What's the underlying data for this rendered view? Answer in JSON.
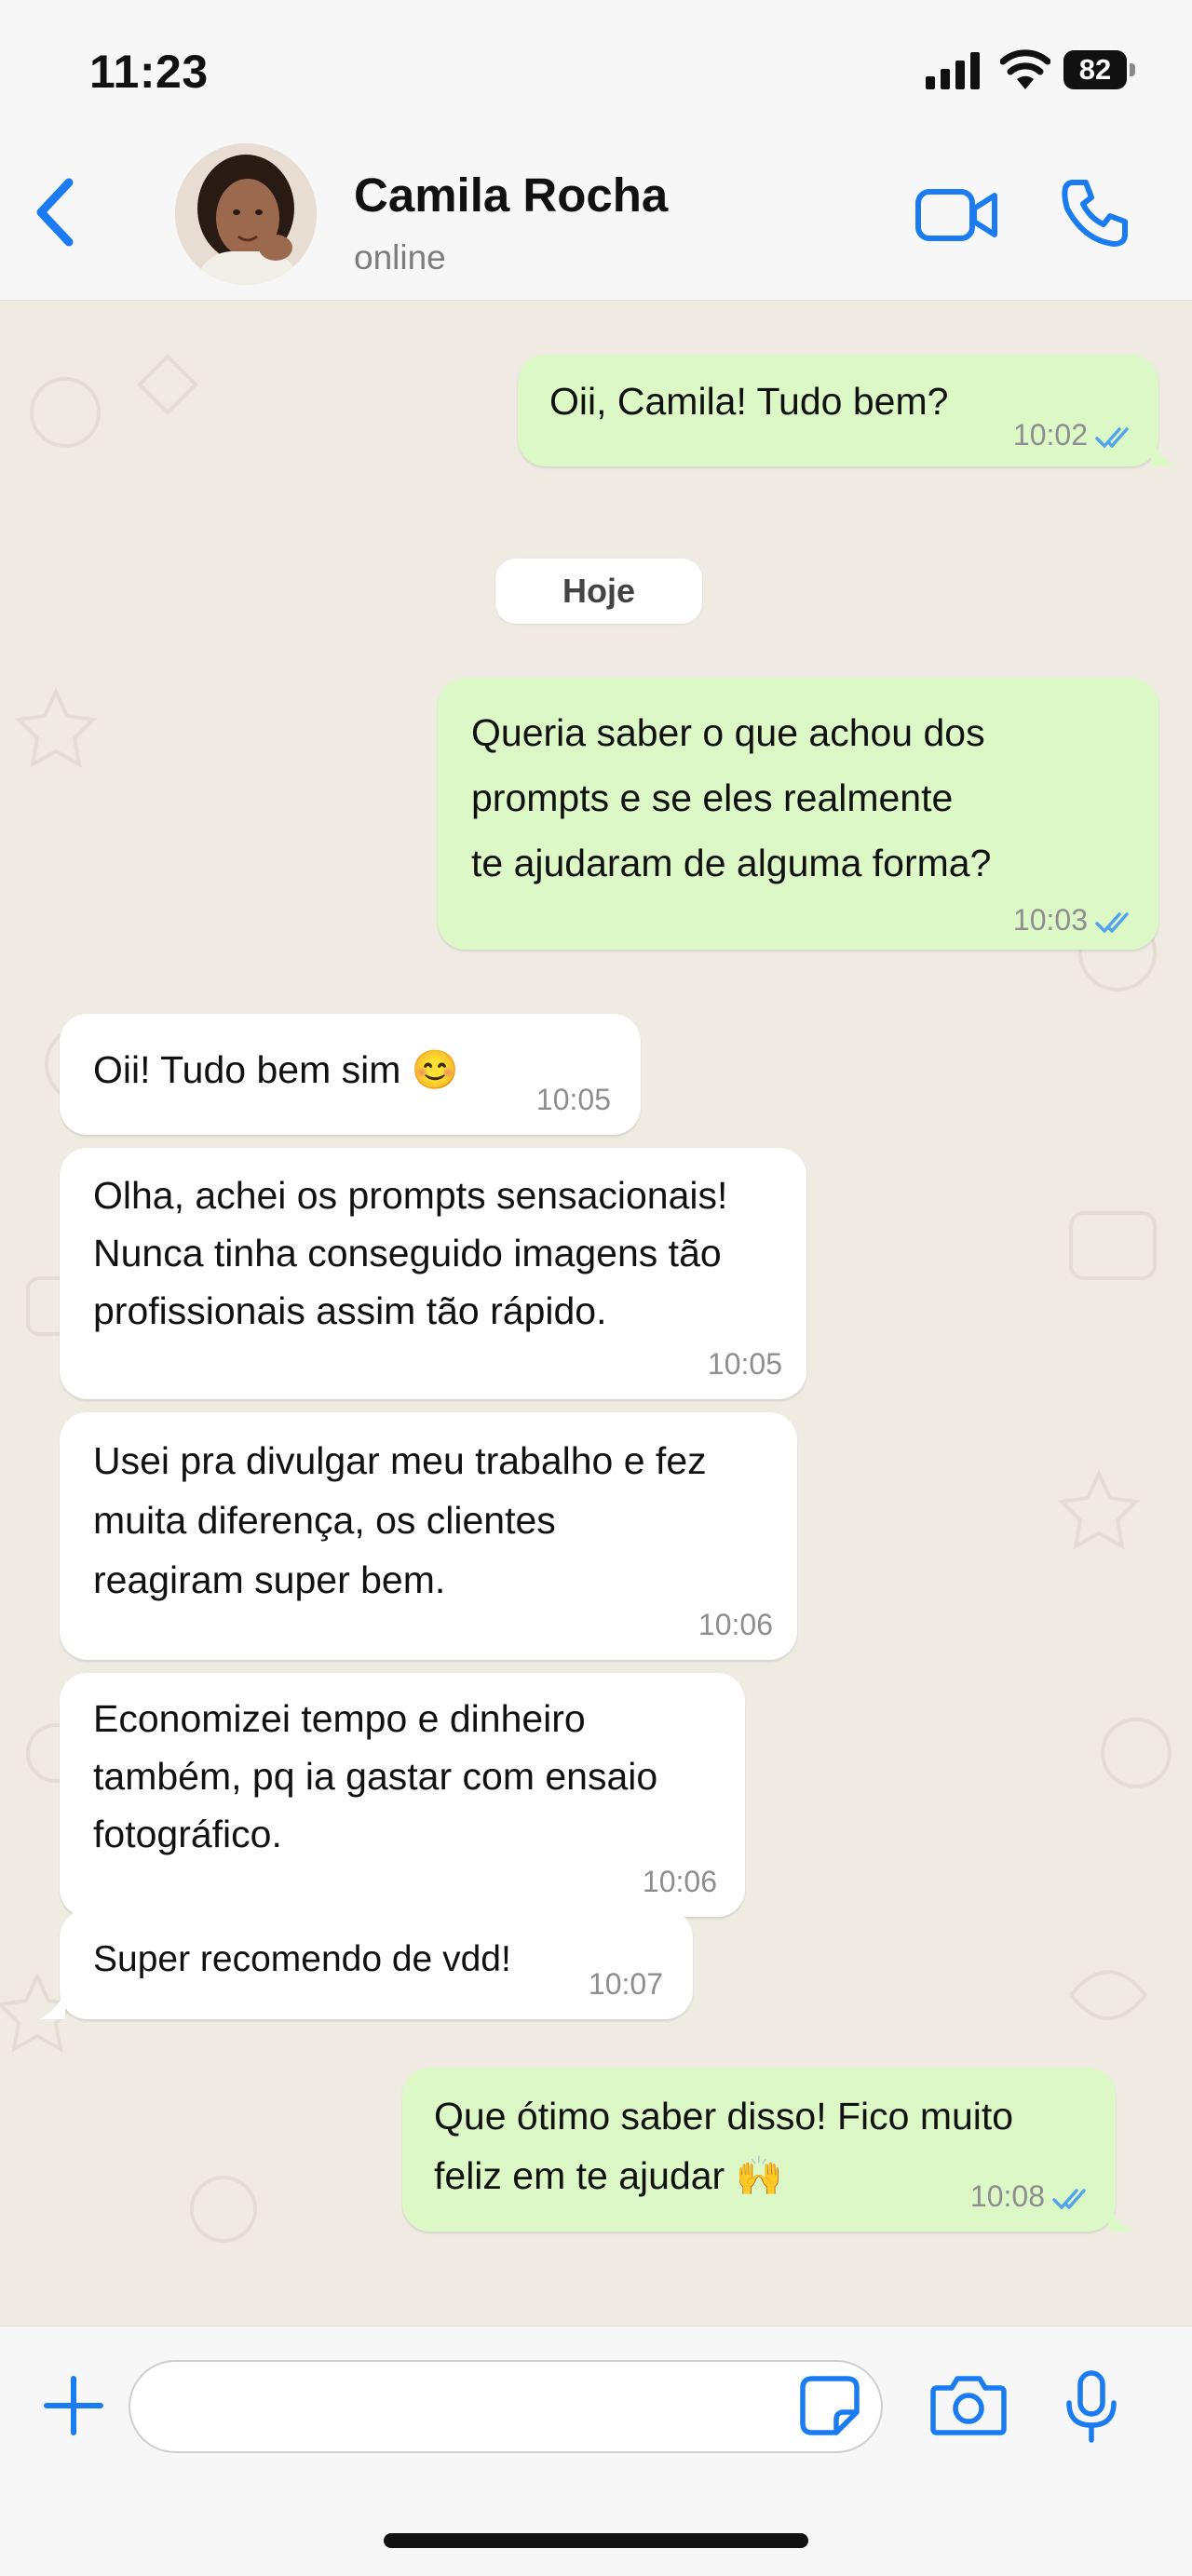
{
  "status_bar": {
    "time": "11:23",
    "battery": "82"
  },
  "header": {
    "contact_name": "Camila Rocha",
    "contact_status": "online"
  },
  "date_separator": "Hoje",
  "messages": [
    {
      "direction": "outgoing",
      "text": "Oii, Camila! Tudo bem?",
      "time": "10:02",
      "read": true
    },
    {
      "direction": "outgoing",
      "text": "Queria saber o que achou dos\nprompts e se eles realmente\nte ajudaram de alguma forma?",
      "time": "10:03",
      "read": true
    },
    {
      "direction": "incoming",
      "text": "Oii! Tudo bem sim 😊",
      "time": "10:05"
    },
    {
      "direction": "incoming",
      "text": "Olha, achei os prompts sensacionais!\nNunca tinha conseguido imagens tão\nprofissionais assim tão rápido.",
      "time": "10:05"
    },
    {
      "direction": "incoming",
      "text": "Usei pra divulgar meu trabalho e fez\nmuita diferença, os clientes\nreagiram super bem.",
      "time": "10:06"
    },
    {
      "direction": "incoming",
      "text": "Economizei tempo e dinheiro\ntambém, pq ia gastar com ensaio\nfotográfico.",
      "time": "10:06"
    },
    {
      "direction": "incoming",
      "text": "Super recomendo de vdd!",
      "time": "10:07"
    },
    {
      "direction": "outgoing",
      "text": "Que ótimo saber disso! Fico muito\nfeliz em te ajudar 🙌",
      "time": "10:08",
      "read": true
    }
  ],
  "composer": {
    "input_value": "",
    "placeholder": ""
  },
  "colors": {
    "accent": "#1a7cf0",
    "outgoing_bubble": "#dcf8c6",
    "incoming_bubble": "#ffffff",
    "chat_background": "#efeae2",
    "read_ticks": "#53a3e8"
  },
  "icons": {
    "back": "chevron-left-icon",
    "video": "video-camera-icon",
    "call": "phone-icon",
    "add": "plus-icon",
    "sticker": "sticker-icon",
    "camera": "camera-icon",
    "mic": "microphone-icon"
  }
}
